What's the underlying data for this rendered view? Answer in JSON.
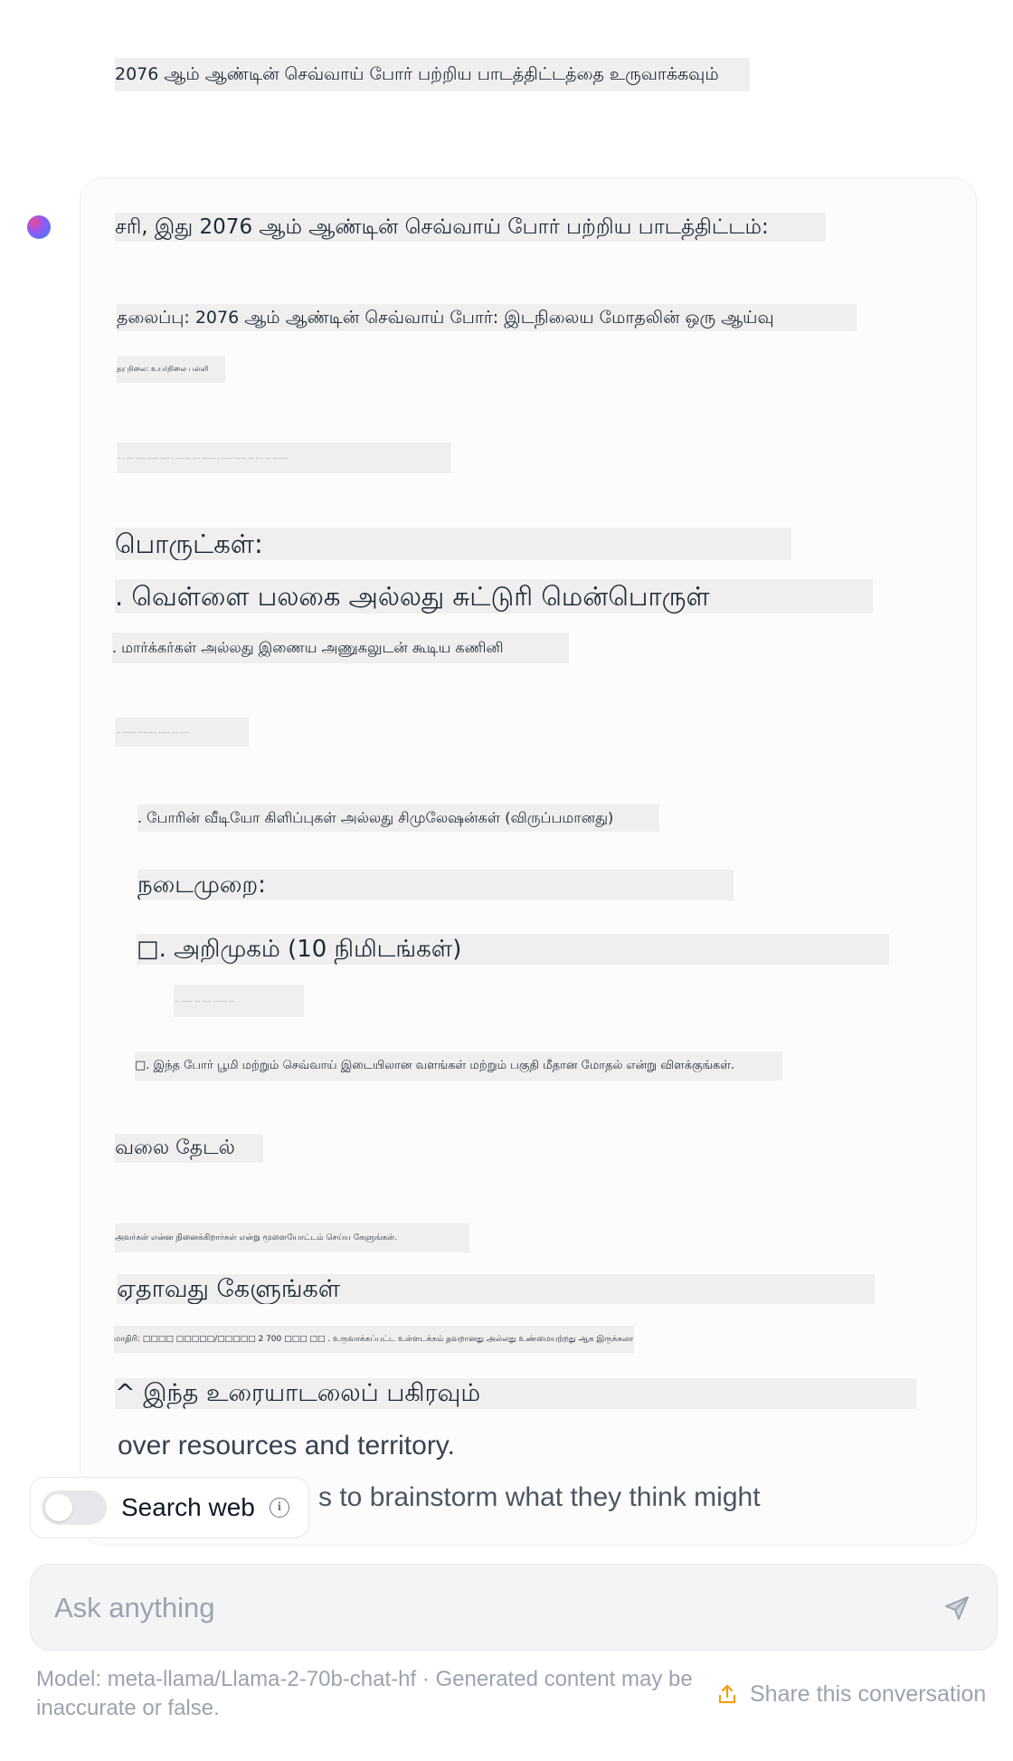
{
  "user_message": "2076 ஆம் ஆண்டின் செவ்வாய் போர் பற்றிய பாடத்திட்டத்தை உருவாக்கவும்",
  "assistant": {
    "intro": "சரி, இது 2076 ஆம் ஆண்டின் செவ்வாய் போர் பற்றிய பாடத்திட்டம்:",
    "title_line": "தலைப்பு: 2076 ஆம் ஆண்டின் செவ்வாய் போர்: இடநிலைய மோதலின் ஒரு ஆய்வு",
    "grade_line": "தர நிலை: உயர்நிலை பள்ளி",
    "materials_heading": "பொருட்கள்:",
    "material_1": ". வெள்ளை பலகை அல்லது சுட்டுரி மென்பொருள்",
    "material_2": ". மார்க்கர்கள் அல்லது இணைய அணுகலுடன் கூடிய கணினி",
    "material_4": ". போரின் வீடியோ கிளிப்புகள் அல்லது சிமுலேஷன்கள் (விருப்பமானது)",
    "procedure_heading": "நடைமுறை:",
    "intro_step": "□. அறிமுகம் (10 நிமிடங்கள்)",
    "explain_line": "□. இந்த போர் பூமி மற்றும் செவ்வாய் இடையிலான வளங்கள் மற்றும் பகுதி மீதான மோதல் என்று விளக்குங்கள்.",
    "web_search": "வலை தேடல்",
    "brainstorm_line": "அவர்கள் என்ன நினைக்கிறார்கள் என்று மூளையோட்டம் செய்ய கேளுங்கள்.",
    "ask_anything": "ஏதாவது கேளுங்கள்",
    "model_disclaimer_tamil": "மாதிரி: □□□□ □□□□□/□□□□□ 2 700 □□□ □□ . உருவாக்கப்பட்ட உள்ளடக்கம் தவறானது அல்லது உண்மையற்றது ஆக இருக்கலாம்.",
    "share_tamil": "^ இந்த உரையாடலைப் பகிரவும்",
    "english_line_1": "over resources and territory.",
    "english_line_2_visible": "s to brainstorm what they think might"
  },
  "search_web": {
    "label": "Search web",
    "enabled": false,
    "info_icon": "info-icon"
  },
  "chat_input": {
    "placeholder": "Ask anything",
    "send_icon": "send-icon"
  },
  "footer": {
    "model_text": "Model: meta-llama/Llama-2-70b-chat-hf · Generated content may be inaccurate or false.",
    "share_label": "Share this conversation",
    "share_icon": "upload-share-icon"
  },
  "colors": {
    "avatar_gradient": [
      "#ec4899",
      "#8b5cf6",
      "#3b82f6"
    ],
    "highlight": "#efefef",
    "muted_text": "#9ca3af",
    "accent_share_icon": "#f59e0b"
  }
}
